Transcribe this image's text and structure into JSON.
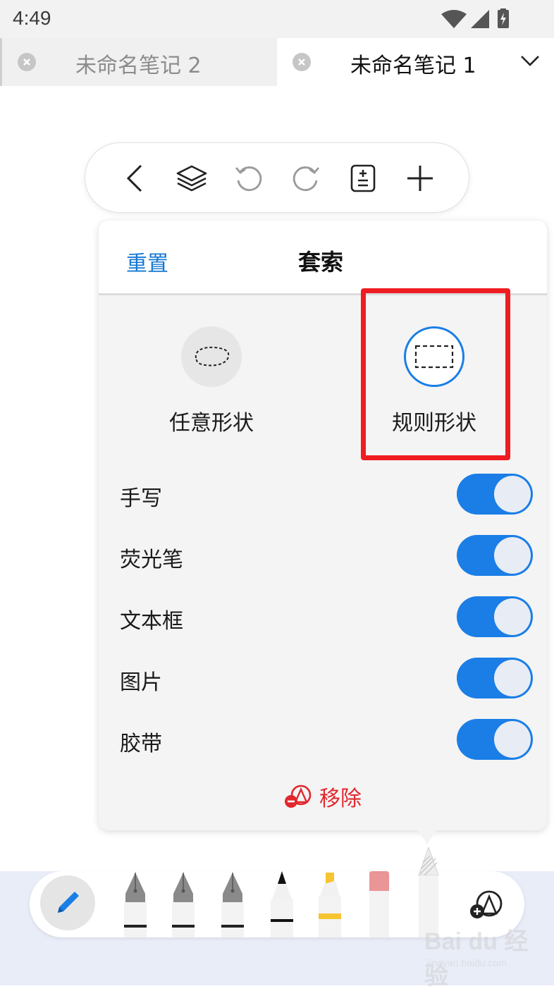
{
  "status": {
    "time": "4:49"
  },
  "tabs": [
    {
      "title": "未命名笔记 2",
      "active": false
    },
    {
      "title": "未命名笔记 1",
      "active": true
    }
  ],
  "toolbar": {
    "icons": [
      "back-icon",
      "layers-icon",
      "undo-icon",
      "redo-icon",
      "page-adjust-icon",
      "add-icon"
    ]
  },
  "lasso_panel": {
    "reset_label": "重置",
    "title": "套索",
    "shapes": [
      {
        "label": "任意形状",
        "selected": false,
        "icon": "freeform-lasso-icon"
      },
      {
        "label": "规则形状",
        "selected": true,
        "icon": "rect-lasso-icon"
      }
    ],
    "options": [
      {
        "label": "手写",
        "on": true
      },
      {
        "label": "荧光笔",
        "on": true
      },
      {
        "label": "文本框",
        "on": true
      },
      {
        "label": "图片",
        "on": true
      },
      {
        "label": "胶带",
        "on": true
      }
    ],
    "remove_label": "移除"
  },
  "colors": {
    "accent": "#1a7ee6",
    "remove_red": "#e0282e",
    "highlight": "#ef1c22"
  },
  "pen_tray": {
    "tools": [
      "pencil-icon",
      "fountain-pen-icon",
      "fountain-pen-icon",
      "fountain-pen-icon",
      "fine-pen-icon",
      "highlighter-icon",
      "eraser-icon",
      "lasso-tool-icon",
      "add-shape-icon"
    ]
  },
  "watermark": {
    "main": "Bai du 经验",
    "sub": "jingyan.baidu.com"
  }
}
